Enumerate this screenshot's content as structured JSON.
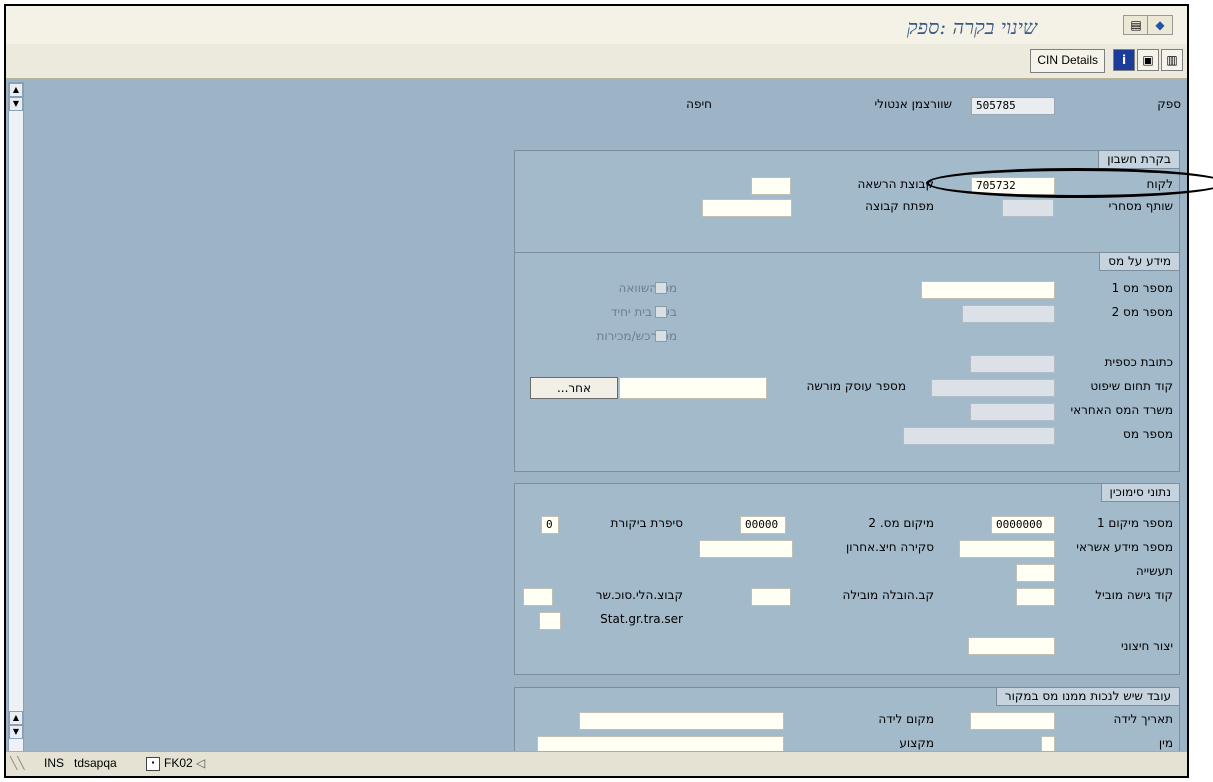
{
  "window": {
    "title": "שינוי בקרה :ספק"
  },
  "toolbar": {
    "cin_details": "CIN Details"
  },
  "header": {
    "supplier_label": "ספק",
    "supplier_value": "505785",
    "name": "שוורצמן אנטולי",
    "city": "חיפה"
  },
  "accounting": {
    "title": "בקרת חשבון",
    "customer_label": "לקוח",
    "customer_value": "705732",
    "auth_group_label": "קבוצת הרשאה",
    "auth_group_value": "",
    "trading_partner_label": "שותף מסחרי",
    "group_key_label": "מפתח קבוצה",
    "group_key_value": ""
  },
  "tax": {
    "title": "מידע על מס",
    "tax1_label": "מספר מס 1",
    "tax1_value": "",
    "tax2_label": "מספר מס 2",
    "equalization_label": "מס השוואה",
    "sole_prop_label": "בעל בית יחיד",
    "sales_purchase_label": "מס רכש/מכירות",
    "fiscal_address_label": "כתובת כספית",
    "jurisdiction_label": "קוד תחום שיפוט",
    "licensed_dealer_label": "מספר עוסק מורשה",
    "licensed_dealer_value": "",
    "other_button": "אחר...",
    "tax_office_label": "משרד המס האחראי",
    "tax_number_label": "מספר מס"
  },
  "reference": {
    "title": "נתוני סימוכין",
    "loc1_label": "מספר מיקום 1",
    "loc1_value": "0000000",
    "loc2_label": "מיקום מס. 2",
    "loc2_value": "00000",
    "check_digit_label": "סיפרת ביקורת",
    "check_digit_value": "0",
    "credit_info_label": "מספר מידע אשראי",
    "credit_info_value": "",
    "last_review_label": "סקירה חיצ.אחרון",
    "last_review_value": "",
    "industry_label": "תעשייה",
    "industry_value": "",
    "carrier_access_label": "קוד גישה מוביל",
    "carrier_access_value": "",
    "freight_group_label": "קב.הובלה מובילה",
    "freight_group_value": "",
    "service_group_label": "קבוצ.הלי.סוכ.שר",
    "service_group_value": "",
    "stat_group_label": "Stat.gr.tra.ser",
    "stat_group_value": "",
    "external_manuf_label": "יצור חיצוני",
    "external_manuf_value": ""
  },
  "withholding": {
    "title": "עובד שיש לנכות ממנו מס במקור",
    "birth_date_label": "תאריך לידה",
    "birth_date_value": "",
    "birth_place_label": "מקום לידה",
    "birth_place_value": "",
    "sex_label": "מין",
    "sex_value": "",
    "profession_label": "מקצוע",
    "profession_value": ""
  },
  "status": {
    "mode": "INS",
    "server": "tdsapqa",
    "transaction": "FK02"
  }
}
